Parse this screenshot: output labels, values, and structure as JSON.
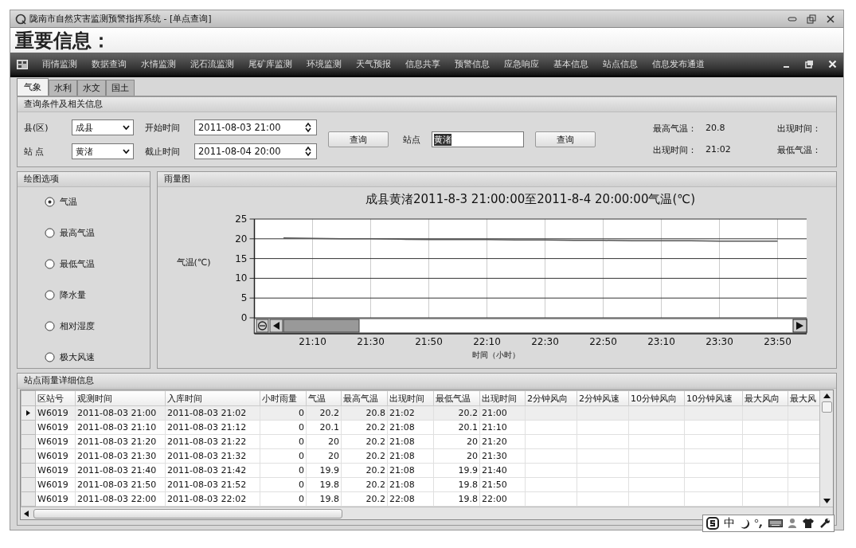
{
  "window": {
    "title": "陇南市自然灾害监测预警指挥系统 - [单点查询]"
  },
  "banner": "重要信息：",
  "menu": {
    "items": [
      "雨情监测",
      "数据查询",
      "水情监测",
      "泥石流监测",
      "尾矿库监测",
      "环境监测",
      "天气预报",
      "信息共享",
      "预警信息",
      "应急响应",
      "基本信息",
      "站点信息",
      "信息发布通道"
    ]
  },
  "tabs": [
    {
      "label": "气象",
      "selected": true
    },
    {
      "label": "水利",
      "selected": false
    },
    {
      "label": "水文",
      "selected": false
    },
    {
      "label": "国土",
      "selected": false
    }
  ],
  "query": {
    "title": "查询条件及相关信息",
    "county": {
      "label": "县(区)",
      "value": "成县"
    },
    "station": {
      "label": "站 点",
      "value": "黄渚"
    },
    "start": {
      "label": "开始时间",
      "value": "2011-08-03 21:00"
    },
    "end": {
      "label": "截止时间",
      "value": "2011-08-04 20:00"
    },
    "query_button": "查询",
    "station_search": {
      "label": "站点",
      "value": "黄渚"
    },
    "search_button": "查询",
    "stats": [
      {
        "label": "最高气温：",
        "value": "20.8"
      },
      {
        "label": "出现时间："
      },
      {
        "label": "出现时间：",
        "value": "21:02"
      },
      {
        "label": "最低气温："
      }
    ]
  },
  "plot_options": {
    "title": "绘图选项",
    "options": [
      {
        "label": "气温",
        "selected": true
      },
      {
        "label": "最高气温",
        "selected": false
      },
      {
        "label": "最低气温",
        "selected": false
      },
      {
        "label": "降水量",
        "selected": false
      },
      {
        "label": "相对湿度",
        "selected": false
      },
      {
        "label": "极大风速",
        "selected": false
      }
    ]
  },
  "chart_panel": {
    "title": "雨量图",
    "chart_data": {
      "type": "line",
      "title": "成县黄渚2011-8-3 21:00:00至2011-8-4 20:00:00气温(℃)",
      "xlabel": "时间（小时）",
      "ylabel": "气温(℃)",
      "categories": [
        null,
        "21:10",
        null,
        "21:30",
        null,
        "21:50",
        null,
        "22:10",
        null,
        "22:30",
        null,
        "22:50",
        null,
        "23:10",
        null,
        "23:30",
        null,
        "23:50"
      ],
      "series": [
        {
          "color": "#555555",
          "values": [
            20.2,
            20.1,
            20,
            20,
            19.9,
            19.8,
            19.8,
            19.8,
            19.7,
            19.7,
            19.6,
            19.6,
            19.5,
            19.5,
            19.5,
            19.4,
            19.4,
            19.4
          ]
        }
      ],
      "ylim": [
        0,
        25
      ],
      "grid": true,
      "yticks": [
        0,
        5,
        10,
        15,
        20,
        25
      ]
    }
  },
  "table": {
    "title": "站点雨量详细信息",
    "columns": [
      "区站号",
      "观测时间",
      "入库时间",
      "小时雨量",
      "气温",
      "最高气温",
      "出现时间",
      "最低气温",
      "出现时间",
      "2分钟风向",
      "2分钟风速",
      "10分钟风向",
      "10分钟风速",
      "最大风向",
      "最大风"
    ],
    "rows": [
      {
        "selected": true,
        "cells": [
          "W6019",
          "2011-08-03 21:00",
          "2011-08-03 21:02",
          "0",
          "20.2",
          "20.8",
          "21:02",
          "20.2",
          "21:00"
        ]
      },
      {
        "selected": false,
        "cells": [
          "W6019",
          "2011-08-03 21:10",
          "2011-08-03 21:12",
          "0",
          "20.1",
          "20.2",
          "21:08",
          "20.1",
          "21:10"
        ]
      },
      {
        "selected": false,
        "cells": [
          "W6019",
          "2011-08-03 21:20",
          "2011-08-03 21:22",
          "0",
          "20",
          "20.2",
          "21:08",
          "20",
          "21:20"
        ]
      },
      {
        "selected": false,
        "cells": [
          "W6019",
          "2011-08-03 21:30",
          "2011-08-03 21:32",
          "0",
          "20",
          "20.2",
          "21:08",
          "20",
          "21:30"
        ]
      },
      {
        "selected": false,
        "cells": [
          "W6019",
          "2011-08-03 21:40",
          "2011-08-03 21:42",
          "0",
          "19.9",
          "20.2",
          "21:08",
          "19.9",
          "21:40"
        ]
      },
      {
        "selected": false,
        "cells": [
          "W6019",
          "2011-08-03 21:50",
          "2011-08-03 21:52",
          "0",
          "19.8",
          "20.2",
          "21:08",
          "19.8",
          "21:50"
        ]
      },
      {
        "selected": false,
        "cells": [
          "W6019",
          "2011-08-03 22:00",
          "2011-08-03 22:02",
          "0",
          "19.8",
          "20.2",
          "22:08",
          "19.8",
          "22:00"
        ]
      }
    ]
  },
  "ime": {
    "mode": "中"
  }
}
